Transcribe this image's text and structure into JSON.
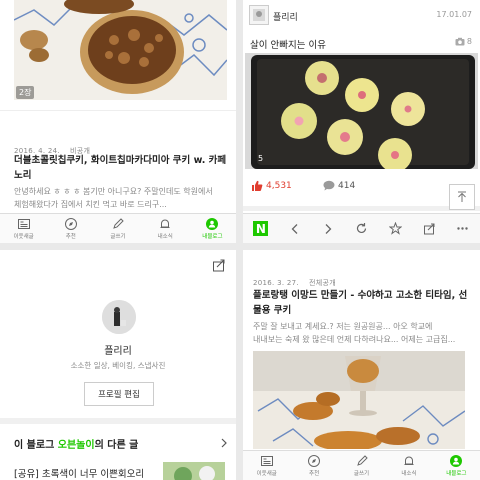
{
  "top_left": {
    "photo_index": "2장",
    "post_date": "2016. 4. 24.",
    "post_visibility": "비공개",
    "post_title": "더블초콜릿칩쿠키, 화이트칩마카다미아 쿠키 w. 카페노리",
    "post_excerpt_1": "안녕하세요 ㅎ ㅎ ㅎ 봄기만 아니구요? 주말인데도 학원에서",
    "post_excerpt_2": "체험해왔다가 집에서 치킨 먹고 바로 드리구...",
    "tabs": [
      "이웃새글",
      "추천",
      "글쓰기",
      "내소식",
      "내블로그"
    ]
  },
  "top_right": {
    "blog_name": "플리리",
    "date": "17.01.07",
    "post_title": "살이 안빠지는 이유",
    "photo_count": "8",
    "photo_index": "5",
    "likes": "4,531",
    "comments": "414"
  },
  "bottom_left": {
    "profile_name": "플리리",
    "profile_desc": "소소한 일상, 베이킹, 스냅사진",
    "edit_profile_button": "프로필 편집",
    "other_posts_prefix": "이 블로그",
    "other_posts_category": "오븐놀이",
    "other_posts_suffix": "의 다른 글",
    "other_post_title": "[공유] 초록색이 너무 이쁜회오리"
  },
  "bottom_right": {
    "browser_logo": "N",
    "post_date": "2016. 3. 27.",
    "post_visibility": "전체공개",
    "post_title": "플로랑탱 이망드 만들기 - 수야하고 고소한 티타임, 선물용 쿠키",
    "post_excerpt_1": "주말 잘 보내고 계세요.? 저는 원공원공... 아오 학교에",
    "post_excerpt_2": "내내보는 숙제 왔 많은데 언제 다하려나요... 어제는 고급집...",
    "tabs": [
      "이웃새글",
      "추천",
      "글쓰기",
      "내소식",
      "내블로그"
    ]
  },
  "colors": {
    "naver_green": "#1ec800",
    "like_red": "#e03d2f",
    "category_green": "#1ec800"
  }
}
